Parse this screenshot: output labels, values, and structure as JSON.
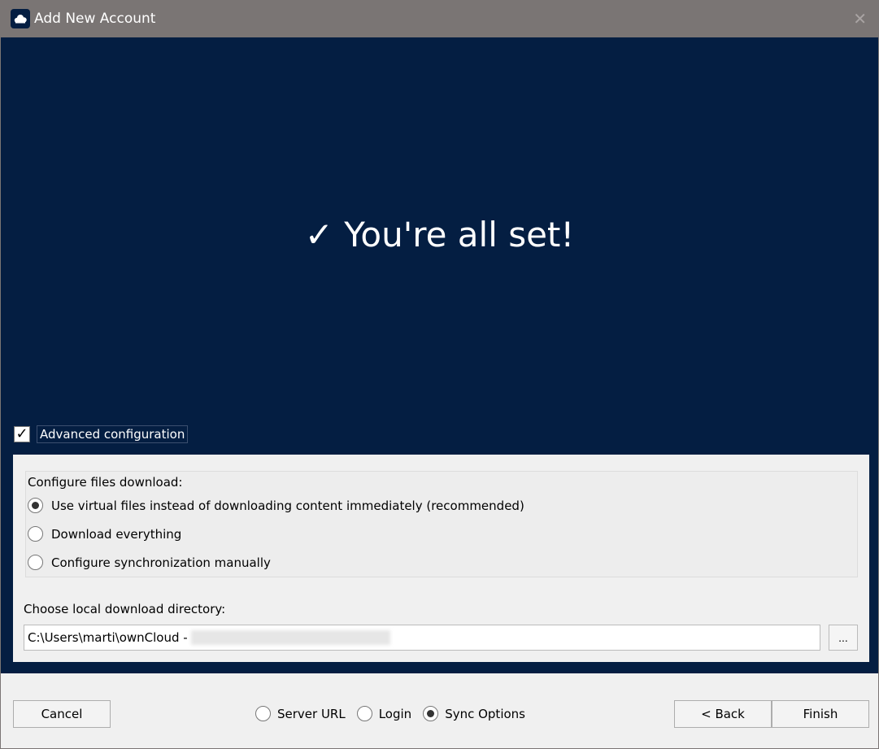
{
  "window": {
    "title": "Add New Account",
    "close_icon": "close-icon",
    "app_icon": "owncloud-cloud-icon"
  },
  "banner": {
    "heading": "✓ You're all set!",
    "color": "#041e42"
  },
  "advanced": {
    "label": "Advanced configuration",
    "checked": true
  },
  "download": {
    "title": "Configure files download:",
    "options": [
      {
        "label": "Use virtual files instead of downloading content immediately (recommended)",
        "selected": true
      },
      {
        "label": "Download everything",
        "selected": false
      },
      {
        "label": "Configure synchronization manually",
        "selected": false
      }
    ]
  },
  "directory": {
    "label": "Choose local download directory:",
    "value_prefix": "C:\\Users\\marti\\ownCloud -",
    "browse_label": "..."
  },
  "footer": {
    "cancel": "Cancel",
    "steps": [
      {
        "label": "Server URL",
        "selected": false
      },
      {
        "label": "Login",
        "selected": false
      },
      {
        "label": "Sync Options",
        "selected": true
      }
    ],
    "back": "< Back",
    "finish": "Finish"
  }
}
